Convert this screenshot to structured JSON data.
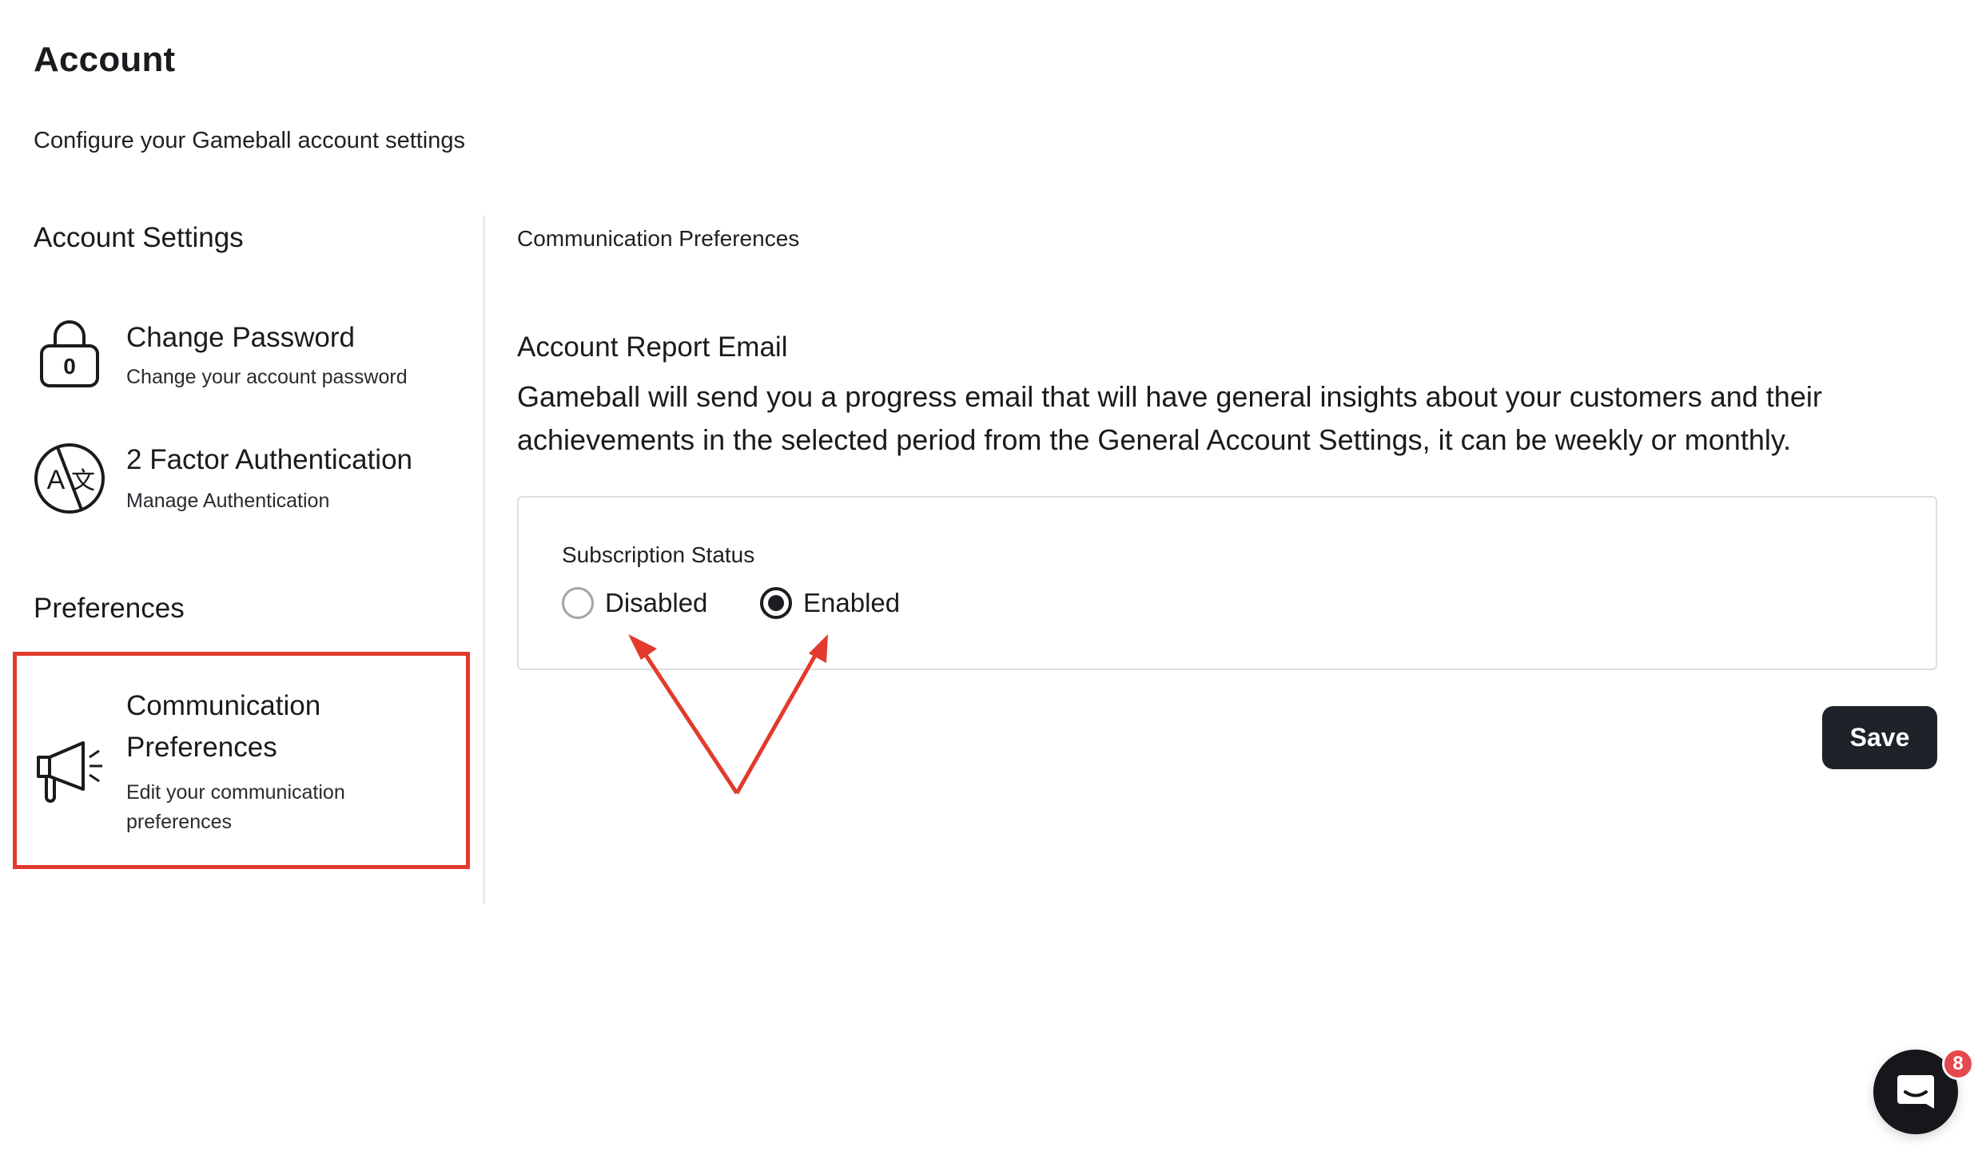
{
  "header": {
    "title": "Account",
    "subtitle": "Configure your Gameball account settings"
  },
  "sidebar": {
    "account_settings_heading": "Account Settings",
    "preferences_heading": "Preferences",
    "items": [
      {
        "icon": "lock-icon",
        "icon_text": "0",
        "title": "Change Password",
        "description": "Change your account password"
      },
      {
        "icon": "translate-icon",
        "title": "2 Factor Authentication",
        "description": "Manage Authentication"
      },
      {
        "icon": "megaphone-icon",
        "title_line1": "Communication",
        "title_line2": "Preferences",
        "description_line1": "Edit your communication",
        "description_line2": "preferences",
        "selected": true
      }
    ]
  },
  "main": {
    "breadcrumb": "Communication Preferences",
    "report_title": "Account Report Email",
    "report_description": "Gameball will send you a progress email that will have general insights about your customers and their achievements in the selected period from the General Account Settings, it can be weekly or monthly.",
    "subscription": {
      "label": "Subscription Status",
      "options": [
        {
          "label": "Disabled",
          "checked": false
        },
        {
          "label": "Enabled",
          "checked": true
        }
      ]
    },
    "save_label": "Save"
  },
  "chat": {
    "badge_count": "8",
    "icon": "chat-icon"
  },
  "colors": {
    "annotation": "#e23a2c",
    "button_bg": "#1e2229",
    "badge": "#e5484d"
  }
}
